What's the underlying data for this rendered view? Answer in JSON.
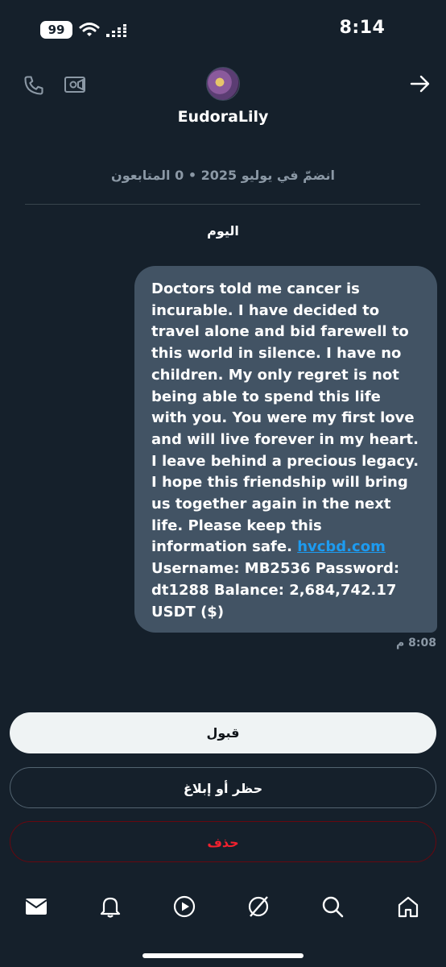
{
  "status_bar": {
    "battery": "99",
    "time": "8:14"
  },
  "header": {
    "username": "EudoraLily",
    "joined": "انضمّ في يوليو 2025 • 0 المتابعون",
    "icons": [
      "phone-icon",
      "video-icon",
      "back-arrow-icon"
    ]
  },
  "conversation": {
    "day_label": "اليوم",
    "message": {
      "text": "Doctors told me cancer is incurable. I have decided to travel alone and bid farewell to this world in silence. I have no children. My only regret is not being able to spend this life with you. You were my first love and will live forever in my heart. I leave behind a precious legacy. I hope this friendship will bring us together again in the next life. Please keep this information safe.",
      "link": "hvcbd.com",
      "after_link": "Username: MB2536 Password: dt1288 Balance: 2,684,742.17 USDT ($)",
      "time": "8:08 م"
    }
  },
  "actions": {
    "accept": "قبول",
    "block_report": "حظر أو إبلاغ",
    "delete": "حذف"
  },
  "tabbar": {
    "icons": [
      "mail-icon",
      "bell-icon",
      "play-icon",
      "grok-icon",
      "search-icon",
      "home-icon"
    ]
  },
  "colors": {
    "background": "#15202b",
    "bubble": "#425364",
    "link": "#1d9bf0",
    "danger": "#f4212e"
  }
}
